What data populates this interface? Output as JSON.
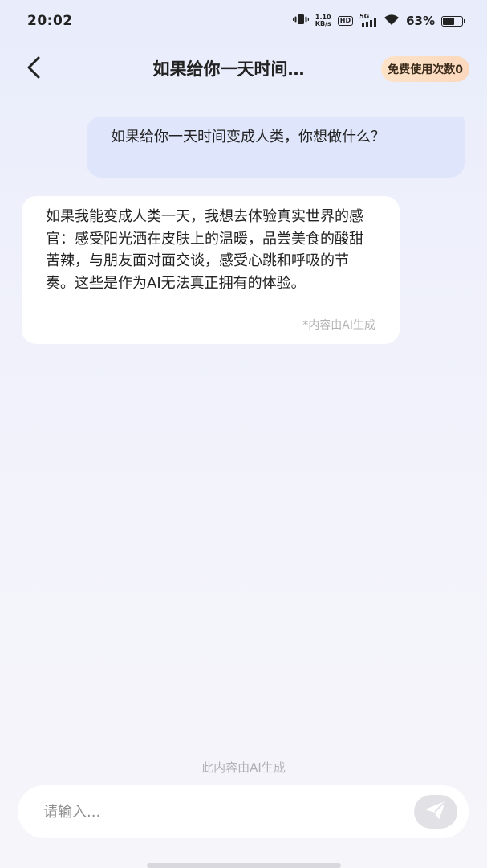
{
  "status_bar": {
    "time": "20:02",
    "net_speed_value": "1.10",
    "net_speed_unit": "KB/s",
    "hd_label": "HD",
    "signal_label": "5G",
    "battery_percent": "63%",
    "battery_level": 0.63,
    "icons": [
      "vibrate-icon",
      "hd-icon",
      "signal-5g-icon",
      "wifi-icon",
      "battery-icon"
    ]
  },
  "header": {
    "title": "如果给你一天时间…",
    "free_uses_label": "免费使用次数0",
    "back_icon": "chevron-left-icon"
  },
  "conversation": {
    "user_message": "如果给你一天时间变成人类，你想做什么？",
    "ai_message": "如果我能变成人类一天，我想去体验真实世界的感官：感受阳光洒在皮肤上的温暖，品尝美食的酸甜苦辣，与朋友面对面交谈，感受心跳和呼吸的节奏。这些是作为AI无法真正拥有的体验。",
    "ai_note": "*内容由AI生成"
  },
  "footer": {
    "ai_generated_note": "此内容由AI生成",
    "input_placeholder": "请输入...",
    "send_icon": "send-icon"
  },
  "colors": {
    "background_top": "#e8ecfb",
    "user_bubble": "#dfe5fa",
    "ai_bubble": "#ffffff",
    "badge_bg": "#fde3c8",
    "send_button_bg": "#e2e2e6"
  }
}
